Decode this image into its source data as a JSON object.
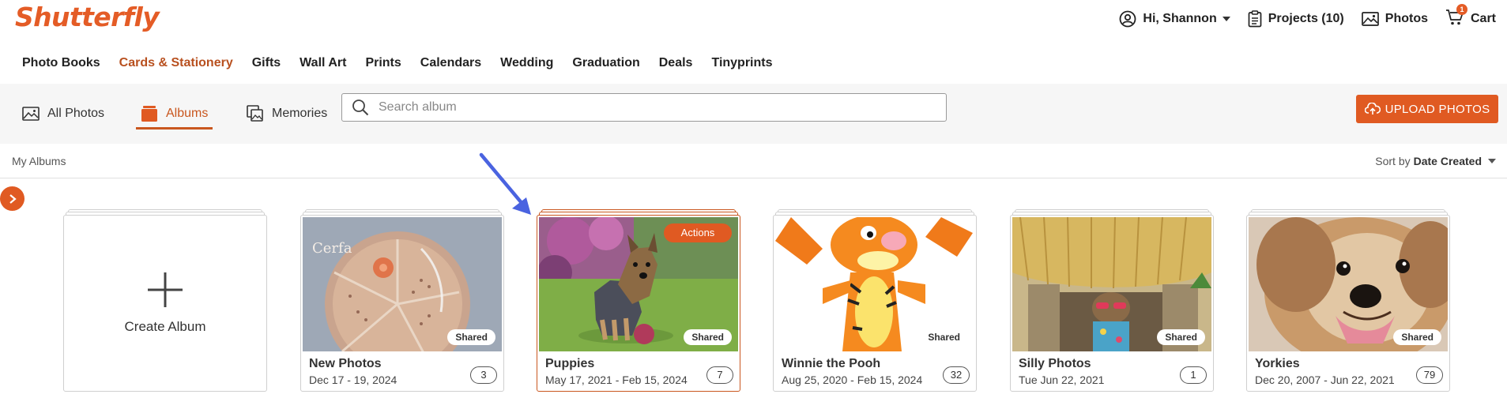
{
  "brand": {
    "name": "Shutterfly",
    "color": "#e45c26"
  },
  "header": {
    "user_greeting": "Hi, Shannon",
    "projects_label": "Projects (10)",
    "photos_label": "Photos",
    "cart_label": "Cart",
    "cart_count": "1"
  },
  "nav": {
    "items": [
      "Photo Books",
      "Cards & Stationery",
      "Gifts",
      "Wall Art",
      "Prints",
      "Calendars",
      "Wedding",
      "Graduation",
      "Deals",
      "Tinyprints"
    ],
    "active_index": 1
  },
  "toolbar": {
    "tabs": [
      {
        "label": "All Photos",
        "icon": "image-icon"
      },
      {
        "label": "Albums",
        "icon": "album-icon",
        "active": true
      },
      {
        "label": "Memories",
        "icon": "memories-icon"
      }
    ],
    "search_placeholder": "Search album",
    "upload_label": "UPLOAD PHOTOS"
  },
  "albums_bar": {
    "title": "My Albums",
    "sort_prefix": "Sort by",
    "sort_value": "Date Created"
  },
  "create_album_label": "Create Album",
  "albums": [
    {
      "title": "New Photos",
      "dates": "Dec 17 - 19, 2024",
      "count": "3",
      "badge": "Shared"
    },
    {
      "title": "Puppies",
      "dates": "May 17, 2021 - Feb 15, 2024",
      "count": "7",
      "badge": "Shared",
      "action": "Actions",
      "selected": true
    },
    {
      "title": "Winnie the Pooh",
      "dates": "Aug 25, 2020 - Feb 15, 2024",
      "count": "32",
      "badge": "Shared"
    },
    {
      "title": "Silly Photos",
      "dates": "Tue Jun 22, 2021",
      "count": "1",
      "badge": "Shared"
    },
    {
      "title": "Yorkies",
      "dates": "Dec 20, 2007 - Jun 22, 2021",
      "count": "79",
      "badge": "Shared"
    }
  ],
  "photo_overlay_text": "Cerfa",
  "colors": {
    "accent": "#e05a22",
    "active_text": "#c9571f",
    "annotation_arrow": "#4a63e0"
  }
}
